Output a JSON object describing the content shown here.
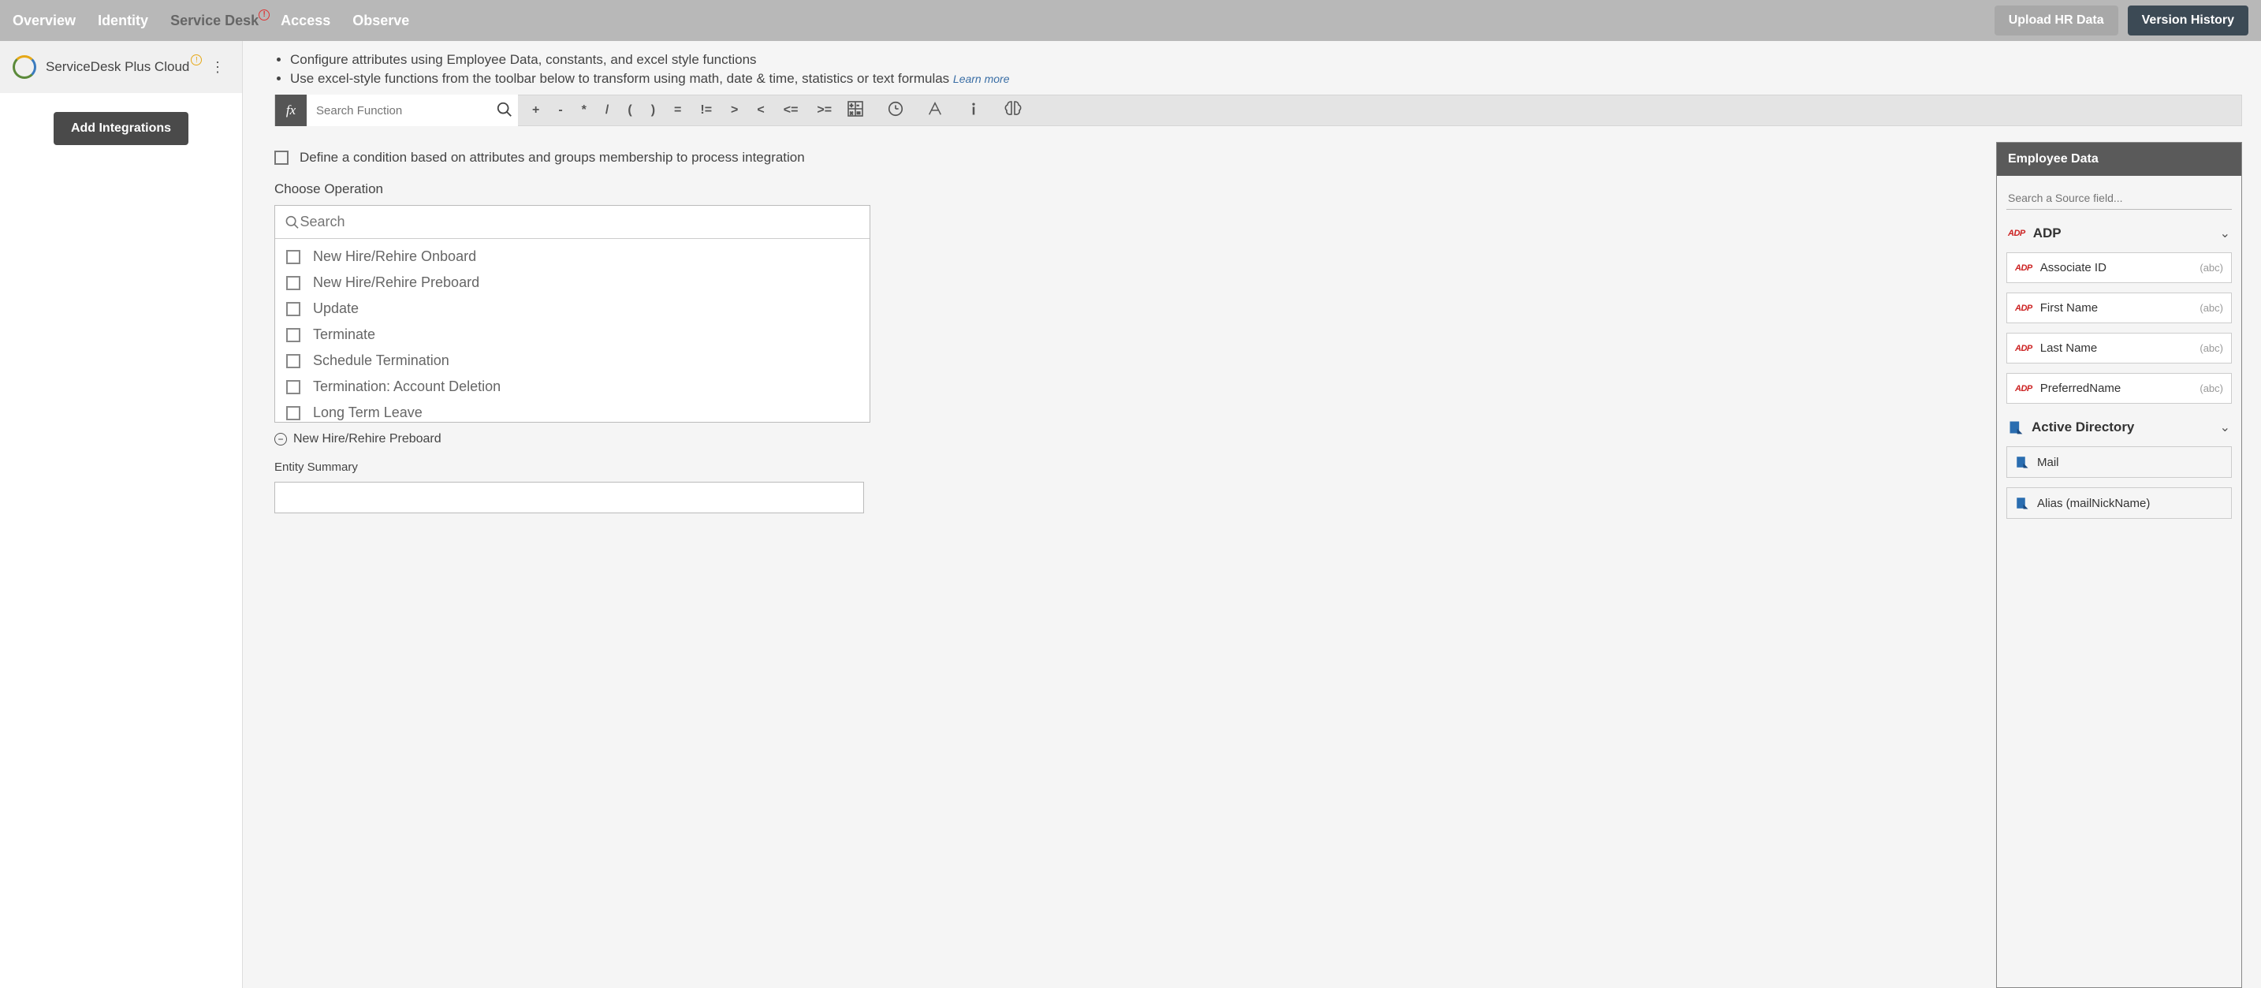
{
  "nav": {
    "tabs": [
      "Overview",
      "Identity",
      "Service Desk",
      "Access",
      "Observe"
    ],
    "active_index": 2,
    "upload_btn": "Upload HR Data",
    "version_btn": "Version History"
  },
  "sidebar": {
    "app_name": "ServiceDesk Plus Cloud",
    "add_btn": "Add Integrations"
  },
  "bullets": [
    "Configure attributes using Employee Data, constants, and excel style functions",
    "Use excel-style functions from the toolbar below to transform using math, date & time, statistics or text formulas"
  ],
  "learn_more": "Learn more",
  "formula": {
    "fx": "fx",
    "search_placeholder": "Search Function",
    "ops": [
      "+",
      "-",
      "*",
      "/",
      "(",
      ")",
      "=",
      "!=",
      ">",
      "<",
      "<=",
      ">="
    ]
  },
  "condition_label": "Define a condition based on attributes and groups membership to process integration",
  "choose_op_label": "Choose Operation",
  "op_search_placeholder": "Search",
  "operations": [
    "New Hire/Rehire Onboard",
    "New Hire/Rehire Preboard",
    "Update",
    "Terminate",
    "Schedule Termination",
    "Termination: Account Deletion",
    "Long Term Leave"
  ],
  "selected_chip": "New Hire/Rehire Preboard",
  "entity_label": "Entity Summary",
  "rpanel": {
    "title": "Employee Data",
    "search_placeholder": "Search a Source field...",
    "groups": [
      {
        "name": "ADP",
        "icon": "adp",
        "fields": [
          {
            "name": "Associate ID",
            "type": "(abc)"
          },
          {
            "name": "First Name",
            "type": "(abc)"
          },
          {
            "name": "Last Name",
            "type": "(abc)"
          },
          {
            "name": "PreferredName",
            "type": "(abc)"
          }
        ]
      },
      {
        "name": "Active Directory",
        "icon": "ad",
        "fields": [
          {
            "name": "Mail",
            "type": ""
          },
          {
            "name": "Alias (mailNickName)",
            "type": ""
          }
        ]
      }
    ]
  }
}
